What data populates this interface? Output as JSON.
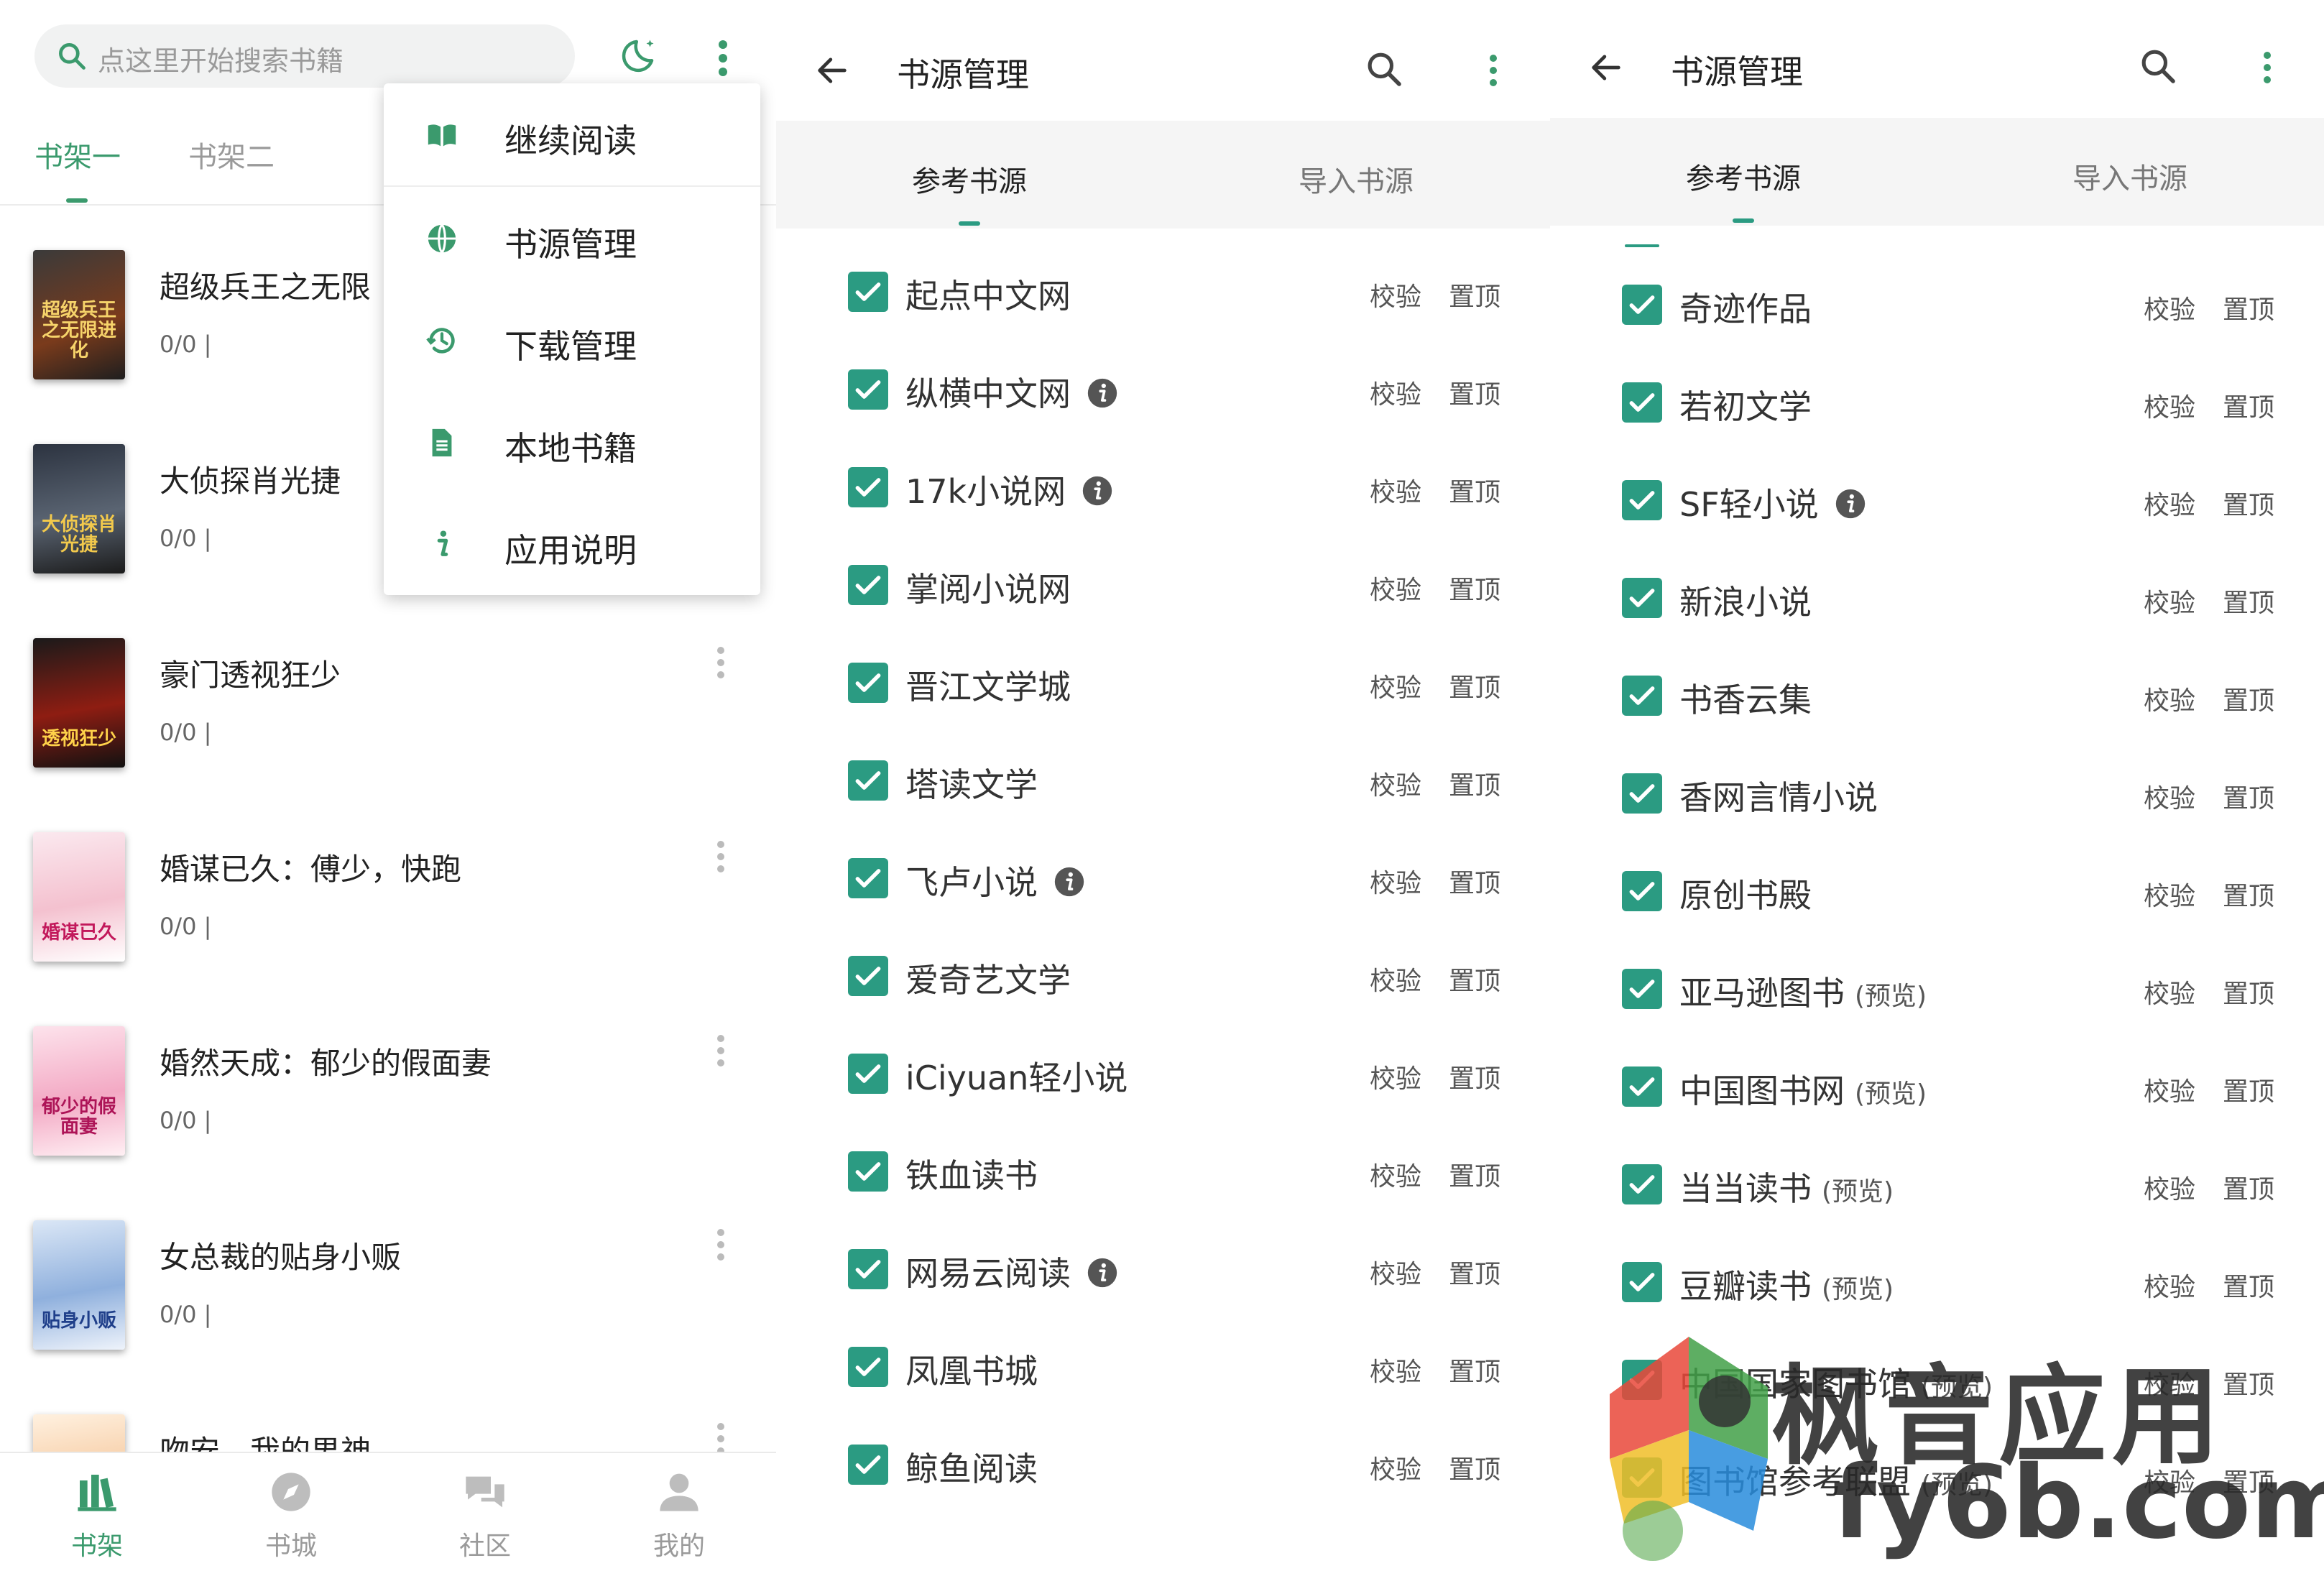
{
  "colors": {
    "accent": "#2b9b82",
    "accent_text": "#3b9a6d",
    "tab_inactive": "#9a9a9a",
    "checkbox": "#2b9b82",
    "divider": "#ececec"
  },
  "left_panel": {
    "search": {
      "placeholder": "点这里开始搜索书籍",
      "icon": "search-icon"
    },
    "toolbar_icons": [
      "night-mode-moon-icon",
      "more-vert-icon"
    ],
    "shelf_tabs": [
      {
        "label": "书架一",
        "active": true
      },
      {
        "label": "书架二",
        "active": false
      }
    ],
    "books": [
      {
        "title": "超级兵王之无限",
        "progress": "0/0 |",
        "cover_text": "超级兵王之无限进化"
      },
      {
        "title": "大侦探肖光捷",
        "progress": "0/0 |",
        "cover_text": "大侦探肖光捷"
      },
      {
        "title": "豪门透视狂少",
        "progress": "0/0 |",
        "cover_text": "透视狂少"
      },
      {
        "title": "婚谋已久：傅少，快跑",
        "progress": "0/0 |",
        "cover_text": "婚谋已久"
      },
      {
        "title": "婚然天成：郁少的假面妻",
        "progress": "0/0 |",
        "cover_text": "郁少的假面妻"
      },
      {
        "title": "女总裁的贴身小贩",
        "progress": "0/0 |",
        "cover_text": "贴身小贩"
      },
      {
        "title": "吻安，我的男神",
        "progress": "",
        "cover_text": ""
      }
    ],
    "menu": [
      {
        "label": "继续阅读",
        "icon": "book-open-icon"
      },
      {
        "label": "书源管理",
        "icon": "globe-icon"
      },
      {
        "label": "下载管理",
        "icon": "history-icon"
      },
      {
        "label": "本地书籍",
        "icon": "file-icon"
      },
      {
        "label": "应用说明",
        "icon": "info-icon"
      }
    ],
    "bottom_nav": [
      {
        "label": "书架",
        "icon": "bookshelf-icon",
        "active": true
      },
      {
        "label": "书城",
        "icon": "compass-icon",
        "active": false
      },
      {
        "label": "社区",
        "icon": "chat-icon",
        "active": false
      },
      {
        "label": "我的",
        "icon": "person-icon",
        "active": false
      }
    ]
  },
  "middle_panel": {
    "title": "书源管理",
    "tabs": [
      {
        "label": "参考书源",
        "active": true
      },
      {
        "label": "导入书源",
        "active": false
      }
    ],
    "action_labels": {
      "verify": "校验",
      "pin": "置顶"
    },
    "sources": [
      {
        "name": "起点中文网",
        "note": "",
        "info": false,
        "checked": true
      },
      {
        "name": "纵横中文网",
        "note": "",
        "info": true,
        "checked": true
      },
      {
        "name": "17k小说网",
        "note": "",
        "info": true,
        "checked": true
      },
      {
        "name": "掌阅小说网",
        "note": "",
        "info": false,
        "checked": true
      },
      {
        "name": "晋江文学城",
        "note": "",
        "info": false,
        "checked": true
      },
      {
        "name": "塔读文学",
        "note": "",
        "info": false,
        "checked": true
      },
      {
        "name": "飞卢小说",
        "note": "",
        "info": true,
        "checked": true
      },
      {
        "name": "爱奇艺文学",
        "note": "",
        "info": false,
        "checked": true
      },
      {
        "name": "iCiyuan轻小说",
        "note": "",
        "info": false,
        "checked": true
      },
      {
        "name": "铁血读书",
        "note": "",
        "info": false,
        "checked": true
      },
      {
        "name": "网易云阅读",
        "note": "",
        "info": true,
        "checked": true
      },
      {
        "name": "凤凰书城",
        "note": "",
        "info": false,
        "checked": true
      },
      {
        "name": "鲸鱼阅读",
        "note": "",
        "info": false,
        "checked": true
      }
    ]
  },
  "right_panel": {
    "title": "书源管理",
    "tabs": [
      {
        "label": "参考书源",
        "active": true
      },
      {
        "label": "导入书源",
        "active": false
      }
    ],
    "action_labels": {
      "verify": "校验",
      "pin": "置顶"
    },
    "sources": [
      {
        "name": "奇迹作品",
        "note": "",
        "info": false,
        "checked": true
      },
      {
        "name": "若初文学",
        "note": "",
        "info": false,
        "checked": true
      },
      {
        "name": "SF轻小说",
        "note": "",
        "info": true,
        "checked": true
      },
      {
        "name": "新浪小说",
        "note": "",
        "info": false,
        "checked": true
      },
      {
        "name": "书香云集",
        "note": "",
        "info": false,
        "checked": true
      },
      {
        "name": "香网言情小说",
        "note": "",
        "info": false,
        "checked": true
      },
      {
        "name": "原创书殿",
        "note": "",
        "info": false,
        "checked": true
      },
      {
        "name": "亚马逊图书",
        "note": "(预览)",
        "info": false,
        "checked": true
      },
      {
        "name": "中国图书网",
        "note": "(预览)",
        "info": false,
        "checked": true
      },
      {
        "name": "当当读书",
        "note": "(预览)",
        "info": false,
        "checked": true
      },
      {
        "name": "豆瓣读书",
        "note": "(预览)",
        "info": false,
        "checked": true
      },
      {
        "name": "中国国家图书馆",
        "note": "(预览)",
        "info": false,
        "checked": true
      },
      {
        "name": "图书馆参考联盟",
        "note": "(预览)",
        "info": false,
        "checked": true
      }
    ]
  },
  "watermark": {
    "line1": "枫音应用",
    "line2": "fy6b.com"
  }
}
